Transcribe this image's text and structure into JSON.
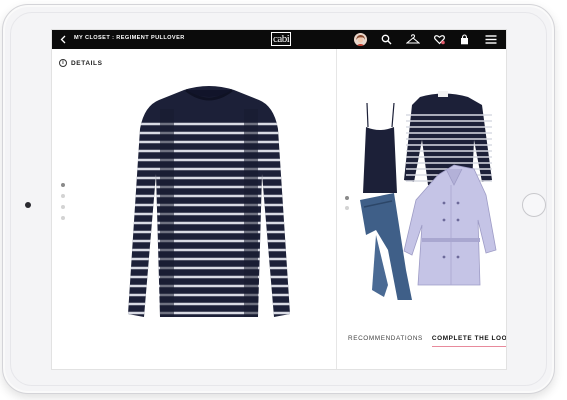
{
  "header": {
    "breadcrumb": "MY CLOSET : REGIMENT PULLOVER",
    "logo": "cabi",
    "icons": [
      "back-arrow-icon",
      "avatar",
      "search-icon",
      "hanger-icon",
      "heart-icon",
      "shopping-bag-icon",
      "hamburger-menu-icon"
    ]
  },
  "details": {
    "label": "DETAILS",
    "icon": "info-icon"
  },
  "product": {
    "name": "Regiment Pullover",
    "colors": {
      "navy": "#1c2038",
      "stripe": "#d9dbe4"
    }
  },
  "carousel": {
    "left_count": 4,
    "left_active": 0,
    "right_count": 2,
    "right_active": 0
  },
  "tabs": [
    {
      "label": "RECOMMENDATIONS",
      "active": false
    },
    {
      "label": "COMPLETE THE LOOK",
      "active": true
    }
  ],
  "colors": {
    "bar": "#0b0b0b",
    "accent": "#e88a9c"
  }
}
